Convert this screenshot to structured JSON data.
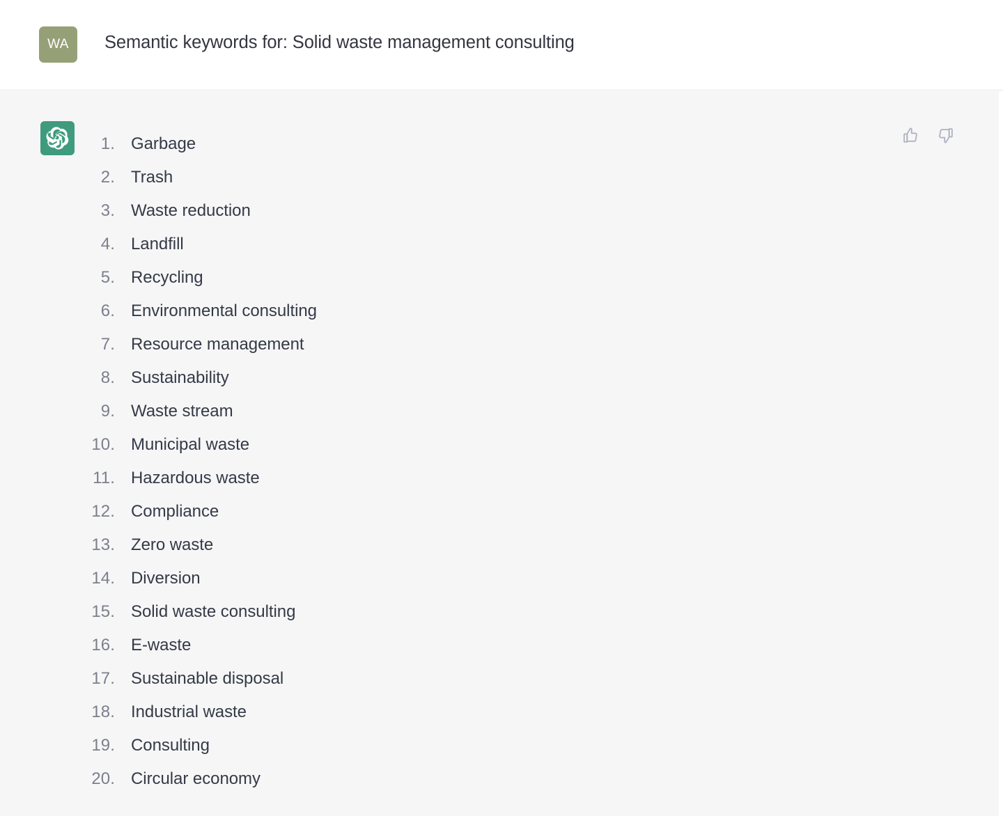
{
  "header": {
    "avatar_initials": "WA",
    "avatar_color": "#96a077",
    "title": "Semantic keywords for: Solid waste management consulting"
  },
  "response": {
    "bot_icon_name": "chatgpt-logo-icon",
    "bot_icon_color": "#3f9b7d",
    "background_color": "#f6f6f7",
    "text_color": "#343a46",
    "number_color": "#7c7f8b",
    "feedback": {
      "thumbs_up_label": "Good response",
      "thumbs_down_label": "Bad response",
      "icon_color": "#aeb0bf"
    },
    "list_items": [
      {
        "number": "1.",
        "text": "Garbage"
      },
      {
        "number": "2.",
        "text": "Trash"
      },
      {
        "number": "3.",
        "text": "Waste reduction"
      },
      {
        "number": "4.",
        "text": "Landfill"
      },
      {
        "number": "5.",
        "text": "Recycling"
      },
      {
        "number": "6.",
        "text": "Environmental consulting"
      },
      {
        "number": "7.",
        "text": "Resource management"
      },
      {
        "number": "8.",
        "text": "Sustainability"
      },
      {
        "number": "9.",
        "text": "Waste stream"
      },
      {
        "number": "10.",
        "text": "Municipal waste"
      },
      {
        "number": "11.",
        "text": "Hazardous waste"
      },
      {
        "number": "12.",
        "text": "Compliance"
      },
      {
        "number": "13.",
        "text": "Zero waste"
      },
      {
        "number": "14.",
        "text": "Diversion"
      },
      {
        "number": "15.",
        "text": "Solid waste consulting"
      },
      {
        "number": "16.",
        "text": "E-waste"
      },
      {
        "number": "17.",
        "text": "Sustainable disposal"
      },
      {
        "number": "18.",
        "text": "Industrial waste"
      },
      {
        "number": "19.",
        "text": "Consulting"
      },
      {
        "number": "20.",
        "text": "Circular economy"
      }
    ]
  }
}
